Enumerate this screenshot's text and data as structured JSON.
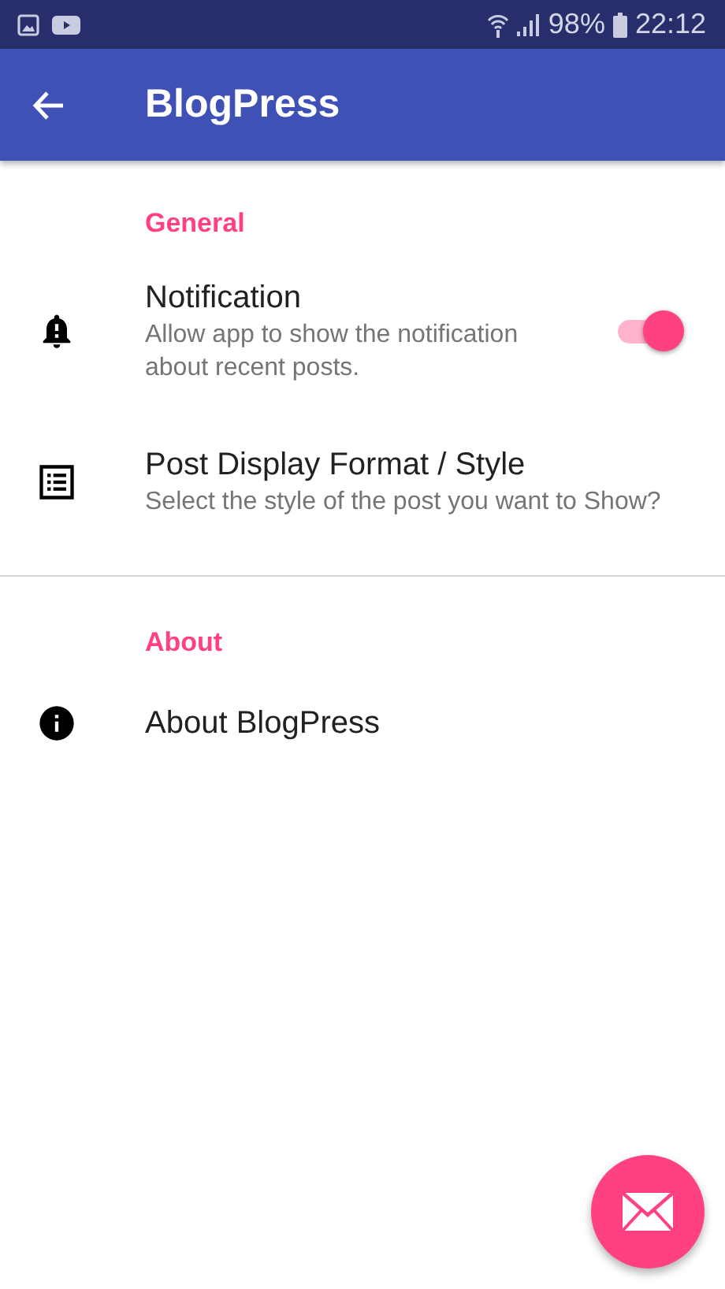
{
  "status_bar": {
    "battery": "98%",
    "time": "22:12"
  },
  "app_bar": {
    "title": "BlogPress"
  },
  "sections": [
    {
      "header": "General",
      "items": [
        {
          "kind": "switch",
          "title": "Notification",
          "summary": "Allow app to show the notification about recent posts.",
          "on": true
        },
        {
          "kind": "plain",
          "title": "Post Display Format / Style",
          "summary": "Select the style of the post you want to Show?"
        }
      ]
    },
    {
      "header": "About",
      "items": [
        {
          "kind": "plain",
          "title": "About BlogPress"
        }
      ]
    }
  ]
}
